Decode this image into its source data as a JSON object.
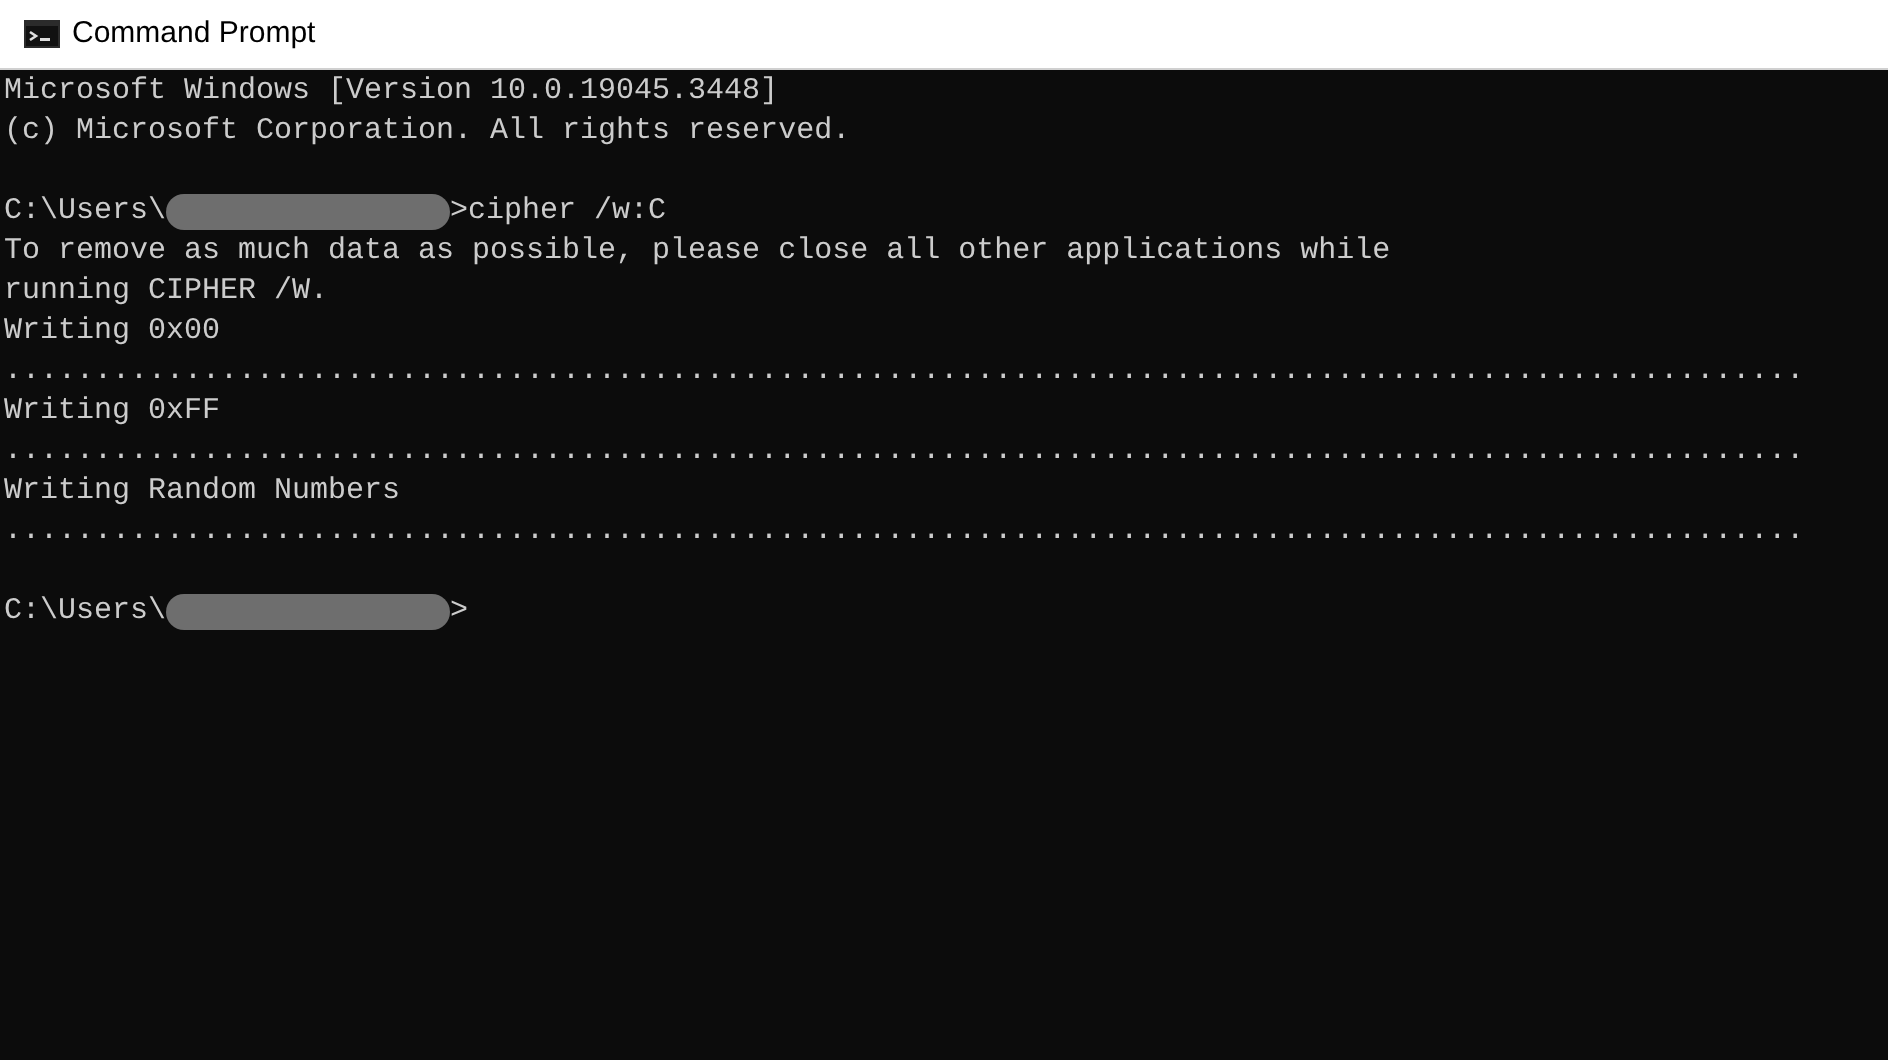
{
  "window": {
    "title": "Command Prompt"
  },
  "console": {
    "lines": [
      {
        "kind": "text",
        "text": "Microsoft Windows [Version 10.0.19045.3448]"
      },
      {
        "kind": "text",
        "text": "(c) Microsoft Corporation. All rights reserved."
      },
      {
        "kind": "blank"
      },
      {
        "kind": "prompt",
        "prefix": "C:\\Users\\",
        "redacted": true,
        "suffix": ">cipher /w:C"
      },
      {
        "kind": "text",
        "text": "To remove as much data as possible, please close all other applications while"
      },
      {
        "kind": "text",
        "text": "running CIPHER /W."
      },
      {
        "kind": "text",
        "text": "Writing 0x00"
      },
      {
        "kind": "text",
        "text": "...................................................................................................."
      },
      {
        "kind": "text",
        "text": "Writing 0xFF"
      },
      {
        "kind": "text",
        "text": "...................................................................................................."
      },
      {
        "kind": "text",
        "text": "Writing Random Numbers"
      },
      {
        "kind": "text",
        "text": "...................................................................................................."
      },
      {
        "kind": "blank"
      },
      {
        "kind": "prompt",
        "prefix": "C:\\Users\\",
        "redacted": true,
        "suffix": ">"
      }
    ]
  }
}
